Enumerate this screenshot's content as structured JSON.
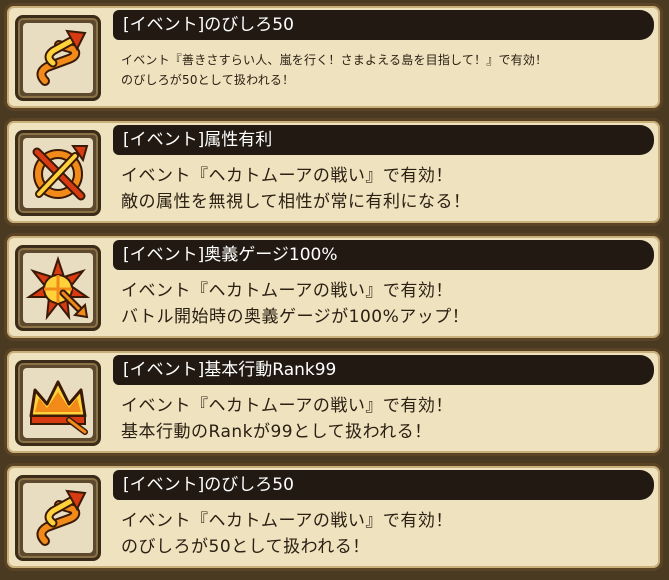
{
  "effects": [
    {
      "title": "[イベント]のびしろ50",
      "lines": [
        "イベント『善きさすらい人、嵐を行く！さまよえる島を目指して！』で有効！",
        "のびしろが50として扱われる！"
      ],
      "icon": "spiral-arrow-icon"
    },
    {
      "title": "[イベント]属性有利",
      "lines": [
        "イベント『ヘカトムーアの戦い』で有効！",
        "敵の属性を無視して相性が常に有利になる！"
      ],
      "icon": "crossed-circle-arrow-icon"
    },
    {
      "title": "[イベント]奥義ゲージ100%",
      "lines": [
        "イベント『ヘカトムーアの戦い』で有効！",
        "バトル開始時の奥義ゲージが100%アップ！"
      ],
      "icon": "burst-wheel-arrow-icon"
    },
    {
      "title": "[イベント]基本行動Rank99",
      "lines": [
        "イベント『ヘカトムーアの戦い』で有効！",
        "基本行動のRankが99として扱われる！"
      ],
      "icon": "crown-arrow-icon"
    },
    {
      "title": "[イベント]のびしろ50",
      "lines": [
        "イベント『ヘカトムーアの戦い』で有効！",
        "のびしろが50として扱われる！"
      ],
      "icon": "spiral-arrow-icon"
    }
  ],
  "colors": {
    "icon_orange": "#f28a1a",
    "icon_red": "#d83a12",
    "icon_yellow": "#ffd23a",
    "icon_outline": "#3a1a06"
  }
}
